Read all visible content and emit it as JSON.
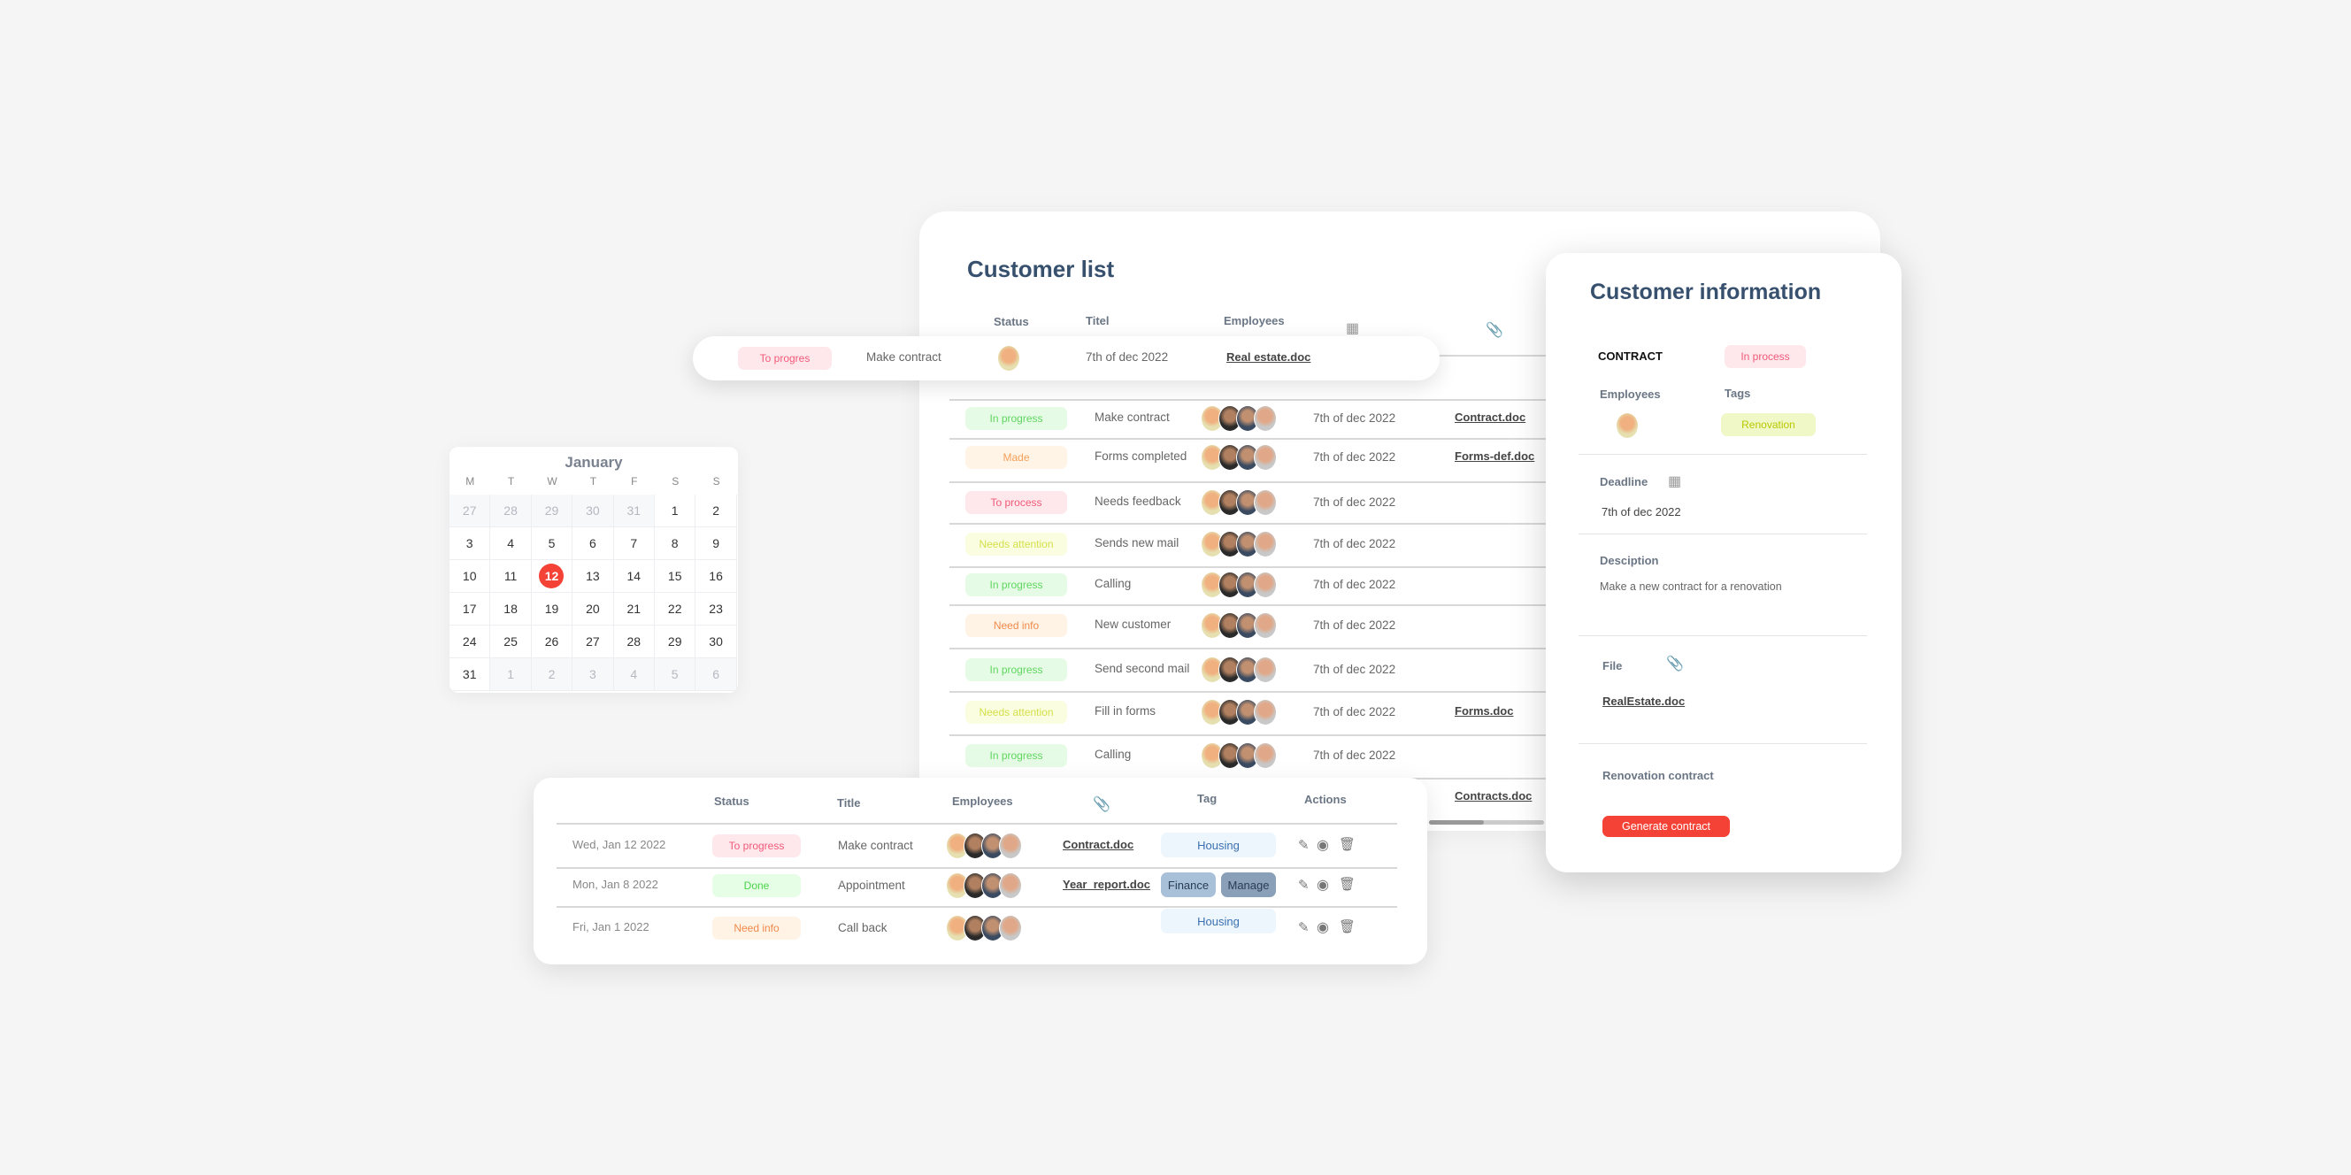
{
  "colors": {
    "accent": "#f44336",
    "title": "#37506e",
    "in_progress": "#5fd65f",
    "made": "#f5a05a",
    "to_process": "#f05a78",
    "needs_attention": "#d4e04a",
    "need_info": "#f08a4a",
    "done": "#4ad44a",
    "renovation": "#b8c800",
    "housing": "#3a70b0"
  },
  "customer_list": {
    "title": "Customer list",
    "headers": {
      "status": "Status",
      "title": "Titel",
      "employees": "Employees",
      "date_icon": "calendar-icon",
      "file_icon": "paperclip-icon"
    },
    "floating_row": {
      "status": "To progres",
      "title": "Make contract",
      "date": "7th of dec 2022",
      "file": "Real estate.doc"
    },
    "rows": [
      {
        "status": "In progress",
        "kind": "in_progress",
        "title": "Make contract",
        "date": "7th of dec 2022",
        "file": "Contract.doc"
      },
      {
        "status": "Made",
        "kind": "made",
        "title": "Forms completed",
        "date": "7th of dec 2022",
        "file": "Forms-def.doc"
      },
      {
        "status": "To process",
        "kind": "to_process",
        "title": "Needs feedback",
        "date": "7th of dec 2022",
        "file": ""
      },
      {
        "status": "Needs attention",
        "kind": "needs_attention",
        "title": "Sends new mail",
        "date": "7th of dec 2022",
        "file": ""
      },
      {
        "status": "In progress",
        "kind": "in_progress",
        "title": "Calling",
        "date": "7th of dec 2022",
        "file": ""
      },
      {
        "status": "Need info",
        "kind": "need_info",
        "title": "New customer",
        "date": "7th of dec 2022",
        "file": ""
      },
      {
        "status": "In progress",
        "kind": "in_progress",
        "title": "Send second mail",
        "date": "7th of dec 2022",
        "file": ""
      },
      {
        "status": "Needs attention",
        "kind": "needs_attention",
        "title": "Fill in forms",
        "date": "7th of dec 2022",
        "file": "Forms.doc"
      },
      {
        "status": "In progress",
        "kind": "in_progress",
        "title": "Calling",
        "date": "7th of dec 2022",
        "file": ""
      }
    ],
    "last_row_file": "Contracts.doc"
  },
  "customer_info": {
    "title": "Customer information",
    "contract_label": "CONTRACT",
    "contract_status": "In process",
    "employees_label": "Employees",
    "tags_label": "Tags",
    "tag": "Renovation",
    "deadline_label": "Deadline",
    "deadline": "7th of dec 2022",
    "description_label": "Desciption",
    "description": "Make a new contract for a renovation",
    "file_label": "File",
    "file": "RealEstate.doc",
    "renovation_label": "Renovation contract",
    "generate_button": "Generate contract"
  },
  "calendar": {
    "month": "January",
    "weekdays": [
      "M",
      "T",
      "W",
      "T",
      "F",
      "S",
      "S"
    ],
    "days": [
      [
        "27",
        "28",
        "29",
        "30",
        "31",
        "1",
        "2"
      ],
      [
        "3",
        "4",
        "5",
        "6",
        "7",
        "8",
        "9"
      ],
      [
        "10",
        "11",
        "12",
        "13",
        "14",
        "15",
        "16"
      ],
      [
        "17",
        "18",
        "19",
        "20",
        "21",
        "22",
        "23"
      ],
      [
        "24",
        "25",
        "26",
        "27",
        "28",
        "29",
        "30"
      ],
      [
        "31",
        "1",
        "2",
        "3",
        "4",
        "5",
        "6"
      ]
    ],
    "selected": "12"
  },
  "tasks_table": {
    "headers": {
      "status": "Status",
      "title": "Title",
      "employees": "Employees",
      "file_icon": "paperclip-icon",
      "tag": "Tag",
      "actions": "Actions"
    },
    "rows": [
      {
        "date": "Wed, Jan 12 2022",
        "status": "To progress",
        "kind": "to_process",
        "title": "Make contract",
        "file": "Contract.doc",
        "tags": [
          "Housing"
        ]
      },
      {
        "date": "Mon, Jan 8 2022",
        "status": "Done",
        "kind": "done",
        "title": "Appointment",
        "file": "Year_report.doc",
        "tags": [
          "Finance",
          "Manage"
        ]
      },
      {
        "date": "Fri, Jan 1 2022",
        "status": "Need info",
        "kind": "need_info",
        "title": "Call back",
        "file": "",
        "tags": [
          "Housing"
        ]
      }
    ]
  }
}
